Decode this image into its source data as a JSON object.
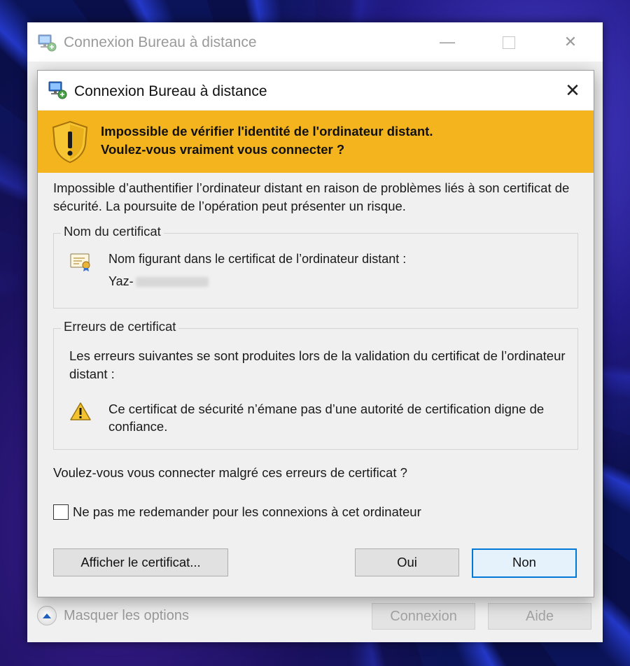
{
  "background_window": {
    "title": "Connexion Bureau à distance",
    "controls": {
      "minimize": "—",
      "close": "✕"
    },
    "options_label": "Masquer les options",
    "connect_label": "Connexion",
    "help_label": "Aide"
  },
  "dialog": {
    "title": "Connexion Bureau à distance",
    "close_glyph": "✕",
    "banner": {
      "line1": "Impossible de vérifier l'identité de l'ordinateur distant.",
      "line2": "Voulez-vous vraiment vous connecter ?",
      "color": "#f4b41e"
    },
    "description": "Impossible d’authentifier l’ordinateur distant en raison de problèmes liés à son certificat de sécurité. La poursuite de l’opération peut présenter un risque.",
    "certificate_group": {
      "title": "Nom du certificat",
      "label": "Nom figurant dans le certificat de l’ordinateur distant :",
      "value_prefix": "Yaz-"
    },
    "errors_group": {
      "title": "Erreurs de certificat",
      "intro": "Les erreurs suivantes se sont produites lors de la validation du certificat de l’ordinateur distant :",
      "item": "Ce certificat de sécurité n’émane pas d’une autorité de certification digne de confiance."
    },
    "question": "Voulez-vous vous connecter malgré ces erreurs de certificat ?",
    "checkbox_label": "Ne pas me redemander pour les connexions à cet ordinateur",
    "checkbox_checked": false,
    "buttons": {
      "view_certificate": "Afficher le certificat...",
      "yes": "Oui",
      "no": "Non"
    },
    "accent_color": "#0078d7"
  }
}
